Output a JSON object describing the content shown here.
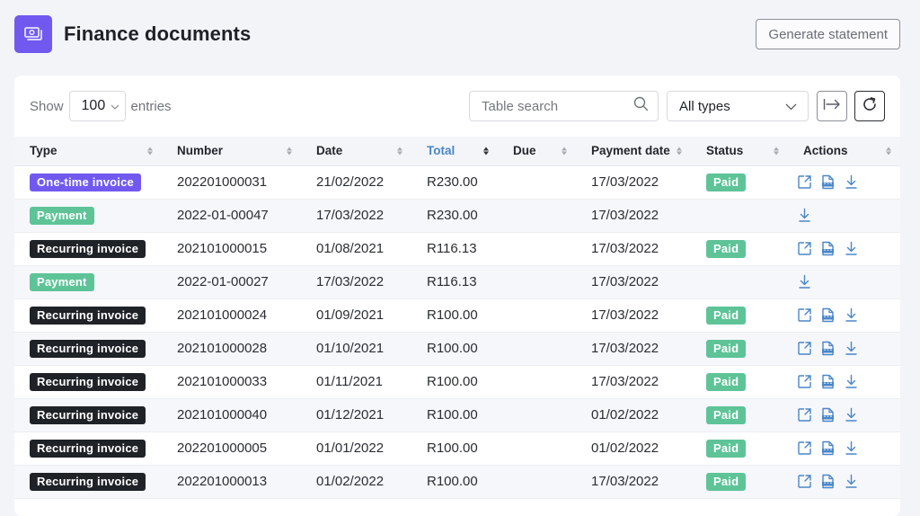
{
  "header": {
    "title": "Finance documents",
    "icon": "money-icon",
    "generate_button": "Generate statement"
  },
  "toolbar": {
    "show_label": "Show",
    "entries_value": "100",
    "entries_label": "entries",
    "search_placeholder": "Table search",
    "search_value": "",
    "type_filter": "All types",
    "export_icon": "export-arrow-icon",
    "refresh_icon": "refresh-icon"
  },
  "table": {
    "columns": [
      {
        "label": "Type",
        "sorted": false
      },
      {
        "label": "Number",
        "sorted": false
      },
      {
        "label": "Date",
        "sorted": false
      },
      {
        "label": "Total",
        "sorted": true
      },
      {
        "label": "Due",
        "sorted": false
      },
      {
        "label": "Payment date",
        "sorted": false
      },
      {
        "label": "Status",
        "sorted": false
      },
      {
        "label": "Actions",
        "sorted": false
      }
    ],
    "rows": [
      {
        "type": "One-time invoice",
        "type_kind": "onetime",
        "number": "202201000031",
        "date": "21/02/2022",
        "total": "R230.00",
        "due": "",
        "payment_date": "17/03/2022",
        "status": "Paid",
        "actions": [
          "open",
          "pdf",
          "download"
        ]
      },
      {
        "type": "Payment",
        "type_kind": "payment",
        "number": "2022-01-00047",
        "date": "17/03/2022",
        "total": "R230.00",
        "due": "",
        "payment_date": "17/03/2022",
        "status": "",
        "actions": [
          "download"
        ]
      },
      {
        "type": "Recurring invoice",
        "type_kind": "recurring",
        "number": "202101000015",
        "date": "01/08/2021",
        "total": "R116.13",
        "due": "",
        "payment_date": "17/03/2022",
        "status": "Paid",
        "actions": [
          "open",
          "pdf",
          "download"
        ]
      },
      {
        "type": "Payment",
        "type_kind": "payment",
        "number": "2022-01-00027",
        "date": "17/03/2022",
        "total": "R116.13",
        "due": "",
        "payment_date": "17/03/2022",
        "status": "",
        "actions": [
          "download"
        ]
      },
      {
        "type": "Recurring invoice",
        "type_kind": "recurring",
        "number": "202101000024",
        "date": "01/09/2021",
        "total": "R100.00",
        "due": "",
        "payment_date": "17/03/2022",
        "status": "Paid",
        "actions": [
          "open",
          "pdf",
          "download"
        ]
      },
      {
        "type": "Recurring invoice",
        "type_kind": "recurring",
        "number": "202101000028",
        "date": "01/10/2021",
        "total": "R100.00",
        "due": "",
        "payment_date": "17/03/2022",
        "status": "Paid",
        "actions": [
          "open",
          "pdf",
          "download"
        ]
      },
      {
        "type": "Recurring invoice",
        "type_kind": "recurring",
        "number": "202101000033",
        "date": "01/11/2021",
        "total": "R100.00",
        "due": "",
        "payment_date": "17/03/2022",
        "status": "Paid",
        "actions": [
          "open",
          "pdf",
          "download"
        ]
      },
      {
        "type": "Recurring invoice",
        "type_kind": "recurring",
        "number": "202101000040",
        "date": "01/12/2021",
        "total": "R100.00",
        "due": "",
        "payment_date": "01/02/2022",
        "status": "Paid",
        "actions": [
          "open",
          "pdf",
          "download"
        ]
      },
      {
        "type": "Recurring invoice",
        "type_kind": "recurring",
        "number": "202201000005",
        "date": "01/01/2022",
        "total": "R100.00",
        "due": "",
        "payment_date": "01/02/2022",
        "status": "Paid",
        "actions": [
          "open",
          "pdf",
          "download"
        ]
      },
      {
        "type": "Recurring invoice",
        "type_kind": "recurring",
        "number": "202201000013",
        "date": "01/02/2022",
        "total": "R100.00",
        "due": "",
        "payment_date": "17/03/2022",
        "status": "Paid",
        "actions": [
          "open",
          "pdf",
          "download"
        ]
      }
    ]
  },
  "colors": {
    "brand": "#7159f0",
    "paid": "#5ec498",
    "recurring": "#1f2227",
    "sorted_header": "#4a86c8",
    "action_icon": "#4a86c8"
  }
}
